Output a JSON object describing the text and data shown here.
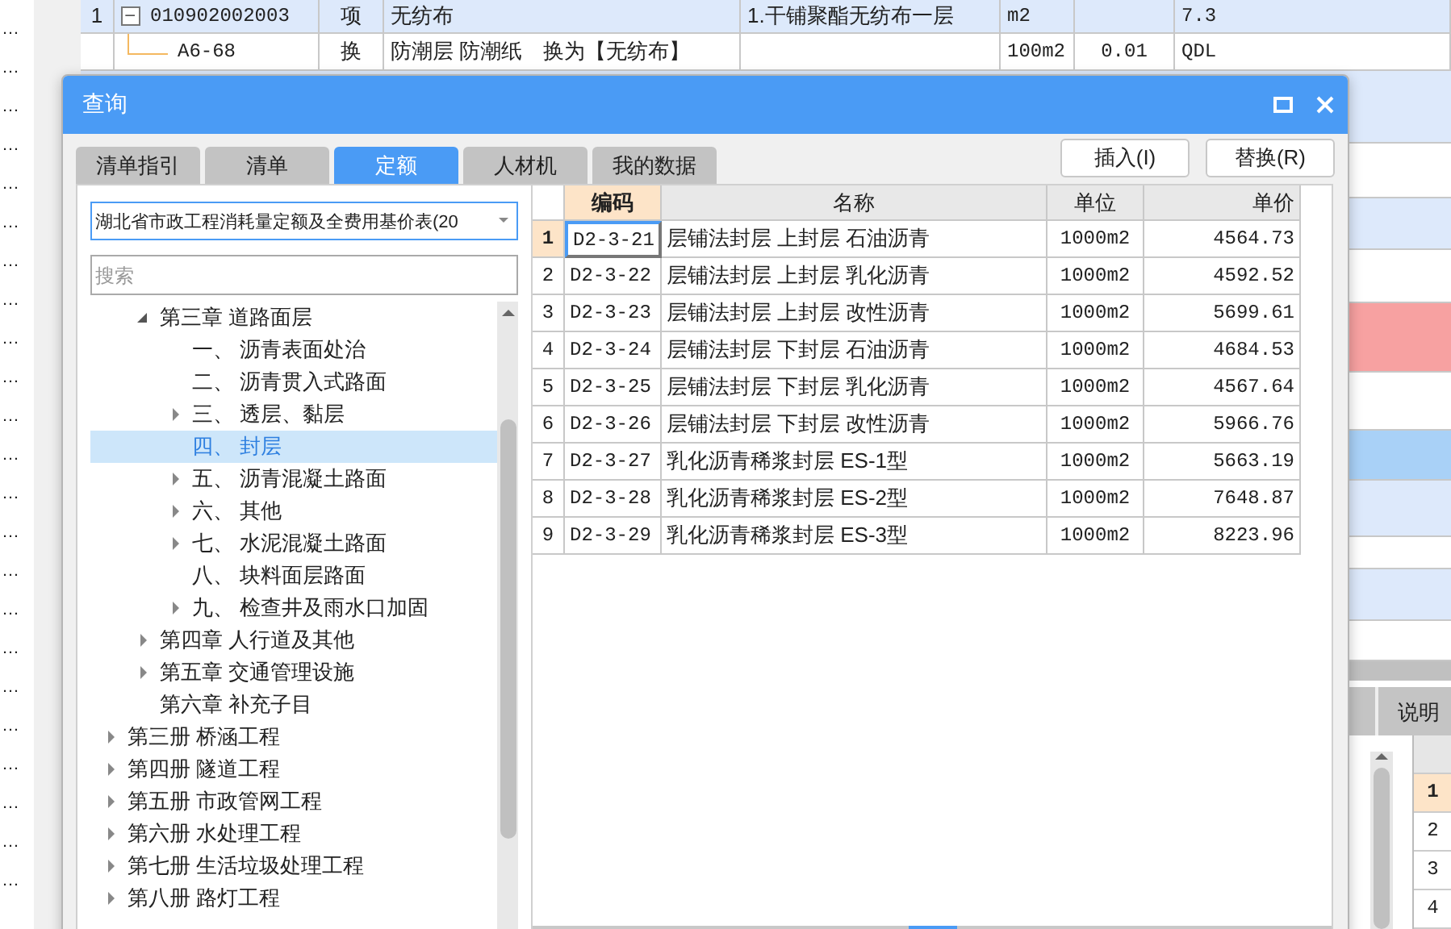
{
  "gutter_marks": [
    "…",
    "…",
    "…",
    "…",
    "…",
    "…",
    "…",
    "…",
    "…",
    "…",
    "…",
    "…",
    "…",
    "…",
    "…",
    "…",
    "…",
    "…",
    "…",
    "…",
    "…",
    "…",
    "…"
  ],
  "top_table": {
    "rows": [
      {
        "num": "1",
        "kind": "parent",
        "expanded": true,
        "code": "010902002003",
        "type": "项",
        "name": "无纺布",
        "desc": "1.干铺聚酯无纺布一层",
        "unit": "m2",
        "qty": "",
        "col_8": "7.3",
        "selected": true
      },
      {
        "num": "",
        "kind": "child",
        "code": "A6-68",
        "type": "换",
        "name": "防潮层 防潮纸　换为【无纺布】",
        "desc": "",
        "unit": "100m2",
        "qty": "0.01",
        "col_8": "QDL",
        "selected": false
      }
    ]
  },
  "lower_pane": {
    "tab": "说明",
    "rows": [
      {
        "num": "1",
        "selected": true
      },
      {
        "num": "2",
        "selected": false
      },
      {
        "num": "3",
        "selected": false
      },
      {
        "num": "4",
        "selected": false
      }
    ]
  },
  "dialog": {
    "title": "查询",
    "tabs": [
      {
        "label": "清单指引",
        "selected": false
      },
      {
        "label": "清单",
        "selected": false
      },
      {
        "label": "定额",
        "selected": true
      },
      {
        "label": "人材机",
        "selected": false
      },
      {
        "label": "我的数据",
        "selected": false
      }
    ],
    "buttons": [
      "插入(I)",
      "替换(R)"
    ],
    "library": "湖北省市政工程消耗量定额及全费用基价表(20",
    "search": {
      "placeholder": "搜索"
    },
    "tree": [
      {
        "children": [
          {
            "label": "第三章 道路面层",
            "kind": "folder",
            "expanded": true,
            "selected": false,
            "children": [
              {
                "label": "一、 沥青表面处治",
                "kind": "leaf",
                "selected": false
              },
              {
                "label": "二、 沥青贯入式路面",
                "kind": "leaf",
                "selected": false
              },
              {
                "label": "三、 透层、黏层",
                "kind": "folder",
                "expanded": false,
                "selected": false
              },
              {
                "label": "四、 封层",
                "kind": "leaf",
                "selected": true
              },
              {
                "label": "五、 沥青混凝土路面",
                "kind": "folder",
                "expanded": false,
                "selected": false
              },
              {
                "label": "六、 其他",
                "kind": "folder",
                "expanded": false,
                "selected": false
              },
              {
                "label": "七、 水泥混凝土路面",
                "kind": "folder",
                "expanded": false,
                "selected": false
              },
              {
                "label": "八、 块料面层路面",
                "kind": "leaf",
                "selected": false
              },
              {
                "label": "九、 检查井及雨水口加固",
                "kind": "folder",
                "expanded": false,
                "selected": false
              }
            ]
          },
          {
            "label": "第四章 人行道及其他",
            "kind": "folder",
            "expanded": false,
            "selected": false
          },
          {
            "label": "第五章 交通管理设施",
            "kind": "folder",
            "expanded": false,
            "selected": false
          },
          {
            "label": "第六章 补充子目",
            "kind": "leaf",
            "selected": false
          }
        ]
      },
      {
        "label": "第三册 桥涵工程",
        "kind": "folder",
        "expanded": false,
        "selected": false
      },
      {
        "label": "第四册 隧道工程",
        "kind": "folder",
        "expanded": false,
        "selected": false
      },
      {
        "label": "第五册 市政管网工程",
        "kind": "folder",
        "expanded": false,
        "selected": false
      },
      {
        "label": "第六册 水处理工程",
        "kind": "folder",
        "expanded": false,
        "selected": false
      },
      {
        "label": "第七册 生活垃圾处理工程",
        "kind": "folder",
        "expanded": false,
        "selected": false
      },
      {
        "label": "第八册 路灯工程",
        "kind": "folder",
        "expanded": false,
        "selected": false
      }
    ],
    "grid": {
      "columns": [
        {
          "label": "编码",
          "highlighted": true
        },
        {
          "label": "名称",
          "highlighted": false
        },
        {
          "label": "单位",
          "highlighted": false
        },
        {
          "label": "单价",
          "highlighted": false
        }
      ],
      "rows": [
        {
          "num": "1",
          "code": "D2-3-21",
          "name": "层铺法封层 上封层 石油沥青",
          "unit": "1000m2",
          "price": "4564.73",
          "selected": true
        },
        {
          "num": "2",
          "code": "D2-3-22",
          "name": "层铺法封层 上封层 乳化沥青",
          "unit": "1000m2",
          "price": "4592.52",
          "selected": false
        },
        {
          "num": "3",
          "code": "D2-3-23",
          "name": "层铺法封层 上封层 改性沥青",
          "unit": "1000m2",
          "price": "5699.61",
          "selected": false
        },
        {
          "num": "4",
          "code": "D2-3-24",
          "name": "层铺法封层 下封层 石油沥青",
          "unit": "1000m2",
          "price": "4684.53",
          "selected": false
        },
        {
          "num": "5",
          "code": "D2-3-25",
          "name": "层铺法封层 下封层 乳化沥青",
          "unit": "1000m2",
          "price": "4567.64",
          "selected": false
        },
        {
          "num": "6",
          "code": "D2-3-26",
          "name": "层铺法封层 下封层 改性沥青",
          "unit": "1000m2",
          "price": "5966.76",
          "selected": false
        },
        {
          "num": "7",
          "code": "D2-3-27",
          "name": "乳化沥青稀浆封层 ES-1型",
          "unit": "1000m2",
          "price": "5663.19",
          "selected": false
        },
        {
          "num": "8",
          "code": "D2-3-28",
          "name": "乳化沥青稀浆封层 ES-2型",
          "unit": "1000m2",
          "price": "7648.87",
          "selected": false
        },
        {
          "num": "9",
          "code": "D2-3-29",
          "name": "乳化沥青稀浆封层 ES-3型",
          "unit": "1000m2",
          "price": "8223.96",
          "selected": false
        }
      ]
    }
  }
}
